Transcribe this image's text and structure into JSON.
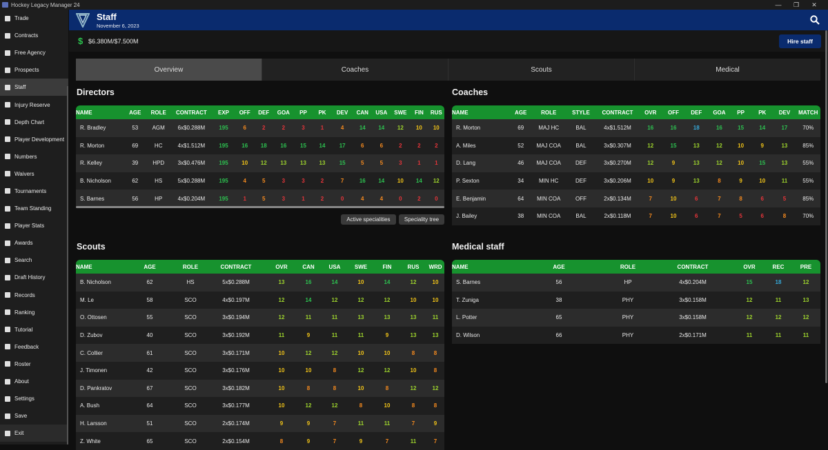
{
  "window": {
    "title": "Hockey Legacy Manager 24",
    "controls": [
      "—",
      "❐",
      "✕"
    ]
  },
  "sidebar": {
    "items": [
      {
        "label": "Trade",
        "icon": "trade-icon"
      },
      {
        "label": "Contracts",
        "icon": "contracts-icon"
      },
      {
        "label": "Free Agency",
        "icon": "free-agency-icon"
      },
      {
        "label": "Prospects",
        "icon": "prospects-icon"
      },
      {
        "label": "Staff",
        "icon": "staff-icon"
      },
      {
        "label": "Injury Reserve",
        "icon": "injury-icon"
      },
      {
        "label": "Depth Chart",
        "icon": "depth-chart-icon"
      },
      {
        "label": "Player Development",
        "icon": "development-icon"
      },
      {
        "label": "Numbers",
        "icon": "numbers-icon"
      },
      {
        "label": "Waivers",
        "icon": "waivers-icon"
      },
      {
        "label": "Tournaments",
        "icon": "tournaments-icon"
      },
      {
        "label": "Team Standing",
        "icon": "standing-icon"
      },
      {
        "label": "Player Stats",
        "icon": "stats-icon"
      },
      {
        "label": "Awards",
        "icon": "awards-icon"
      },
      {
        "label": "Search",
        "icon": "search-icon"
      },
      {
        "label": "Draft History",
        "icon": "draft-icon"
      },
      {
        "label": "Records",
        "icon": "records-icon"
      },
      {
        "label": "Ranking",
        "icon": "ranking-icon"
      },
      {
        "label": "Tutorial",
        "icon": "tutorial-icon"
      },
      {
        "label": "Feedback",
        "icon": "feedback-icon"
      },
      {
        "label": "Roster",
        "icon": "roster-icon"
      },
      {
        "label": "About",
        "icon": "about-icon"
      },
      {
        "label": "Settings",
        "icon": "settings-icon"
      },
      {
        "label": "Save",
        "icon": "save-icon"
      },
      {
        "label": "Exit",
        "icon": "exit-icon"
      }
    ],
    "active": "Staff"
  },
  "header": {
    "title": "Staff",
    "date": "November 6, 2023",
    "color": "#0a2b6e"
  },
  "budget": {
    "symbol": "$",
    "value": "$6.380M/$7.500M",
    "hire_label": "Hire staff"
  },
  "tabs": [
    "Overview",
    "Coaches",
    "Scouts",
    "Medical"
  ],
  "active_tab": "Overview",
  "colors": {
    "green": "#2dc150",
    "light_green": "#9ed42d",
    "yellow": "#f2c418",
    "orange": "#f58a1f",
    "red": "#e6353a",
    "blue": "#36a8d8",
    "header_green": "#17922e"
  },
  "directors": {
    "title": "Directors",
    "columns": [
      "NAME",
      "AGE",
      "ROLE",
      "CONTRACT",
      "EXP",
      "OFF",
      "DEF",
      "GOA",
      "PP",
      "PK",
      "DEV",
      "CAN",
      "USA",
      "SWE",
      "FIN",
      "RUS"
    ],
    "rows": [
      [
        "R. Bradley",
        "53",
        "AGM",
        "6x$0.288M",
        "195",
        "6",
        "2",
        "2",
        "3",
        "1",
        "4",
        "14",
        "14",
        "12",
        "10",
        "10"
      ],
      [
        "R. Morton",
        "69",
        "HC",
        "4x$1.512M",
        "195",
        "16",
        "18",
        "16",
        "15",
        "14",
        "17",
        "6",
        "6",
        "2",
        "2",
        "2"
      ],
      [
        "R. Kelley",
        "39",
        "HPD",
        "3x$0.476M",
        "195",
        "10",
        "12",
        "13",
        "13",
        "13",
        "15",
        "5",
        "5",
        "3",
        "1",
        "1"
      ],
      [
        "B. Nicholson",
        "62",
        "HS",
        "5x$0.288M",
        "195",
        "4",
        "5",
        "3",
        "3",
        "2",
        "7",
        "16",
        "14",
        "10",
        "14",
        "12"
      ],
      [
        "S. Barnes",
        "56",
        "HP",
        "4x$0.204M",
        "195",
        "1",
        "5",
        "3",
        "1",
        "2",
        "0",
        "4",
        "4",
        "0",
        "2",
        "0"
      ]
    ],
    "buttons": [
      "Active specialities",
      "Speciality tree"
    ]
  },
  "coaches": {
    "title": "Coaches",
    "columns": [
      "NAME",
      "AGE",
      "ROLE",
      "STYLE",
      "CONTRACT",
      "OVR",
      "OFF",
      "DEF",
      "GOA",
      "PP",
      "PK",
      "DEV",
      "MATCH"
    ],
    "rows": [
      [
        "R. Morton",
        "69",
        "MAJ HC",
        "BAL",
        "4x$1.512M",
        "16",
        "16",
        "18",
        "16",
        "15",
        "14",
        "17",
        "70%"
      ],
      [
        "A. Miles",
        "52",
        "MAJ COA",
        "BAL",
        "3x$0.307M",
        "12",
        "15",
        "13",
        "12",
        "10",
        "9",
        "13",
        "85%"
      ],
      [
        "D. Lang",
        "46",
        "MAJ COA",
        "DEF",
        "3x$0.270M",
        "12",
        "9",
        "13",
        "12",
        "10",
        "15",
        "13",
        "55%"
      ],
      [
        "P. Sexton",
        "34",
        "MIN HC",
        "DEF",
        "3x$0.206M",
        "10",
        "9",
        "13",
        "8",
        "9",
        "10",
        "11",
        "55%"
      ],
      [
        "E. Benjamin",
        "64",
        "MIN COA",
        "OFF",
        "2x$0.134M",
        "7",
        "10",
        "6",
        "7",
        "8",
        "6",
        "5",
        "85%"
      ],
      [
        "J. Bailey",
        "38",
        "MIN COA",
        "BAL",
        "2x$0.118M",
        "7",
        "10",
        "6",
        "7",
        "5",
        "6",
        "8",
        "70%"
      ]
    ]
  },
  "scouts": {
    "title": "Scouts",
    "columns": [
      "NAME",
      "AGE",
      "ROLE",
      "CONTRACT",
      "OVR",
      "CAN",
      "USA",
      "SWE",
      "FIN",
      "RUS",
      "WRD"
    ],
    "rows": [
      [
        "B. Nicholson",
        "62",
        "HS",
        "5x$0.288M",
        "13",
        "16",
        "14",
        "10",
        "14",
        "12",
        "10"
      ],
      [
        "M. Le",
        "58",
        "SCO",
        "4x$0.197M",
        "12",
        "14",
        "12",
        "12",
        "12",
        "10",
        "10"
      ],
      [
        "O. Ottosen",
        "55",
        "SCO",
        "3x$0.194M",
        "12",
        "11",
        "11",
        "13",
        "13",
        "13",
        "11"
      ],
      [
        "D. Zubov",
        "40",
        "SCO",
        "3x$0.192M",
        "11",
        "9",
        "11",
        "11",
        "9",
        "13",
        "13"
      ],
      [
        "C. Collier",
        "61",
        "SCO",
        "3x$0.171M",
        "10",
        "12",
        "12",
        "10",
        "10",
        "8",
        "8"
      ],
      [
        "J. Timonen",
        "42",
        "SCO",
        "3x$0.176M",
        "10",
        "10",
        "8",
        "12",
        "12",
        "10",
        "8"
      ],
      [
        "D. Pankratov",
        "67",
        "SCO",
        "3x$0.182M",
        "10",
        "8",
        "8",
        "10",
        "8",
        "12",
        "12"
      ],
      [
        "A. Bush",
        "64",
        "SCO",
        "3x$0.177M",
        "10",
        "12",
        "12",
        "8",
        "10",
        "8",
        "8"
      ],
      [
        "H. Larsson",
        "51",
        "SCO",
        "2x$0.174M",
        "9",
        "9",
        "7",
        "11",
        "11",
        "7",
        "9"
      ],
      [
        "Z. White",
        "65",
        "SCO",
        "2x$0.154M",
        "8",
        "9",
        "7",
        "9",
        "7",
        "11",
        "7"
      ]
    ]
  },
  "medical": {
    "title": "Medical staff",
    "columns": [
      "NAME",
      "AGE",
      "ROLE",
      "CONTRACT",
      "OVR",
      "REC",
      "PRE"
    ],
    "rows": [
      [
        "S. Barnes",
        "56",
        "HP",
        "4x$0.204M",
        "15",
        "18",
        "12"
      ],
      [
        "T. Zuniga",
        "38",
        "PHY",
        "3x$0.158M",
        "12",
        "11",
        "13"
      ],
      [
        "L. Potter",
        "65",
        "PHY",
        "3x$0.158M",
        "12",
        "12",
        "12"
      ],
      [
        "D. Wilson",
        "66",
        "PHY",
        "2x$0.171M",
        "11",
        "11",
        "11"
      ]
    ]
  }
}
